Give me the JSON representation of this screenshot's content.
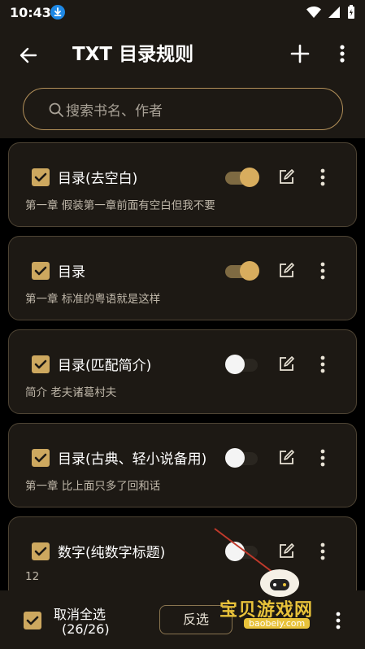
{
  "status_bar": {
    "time": "10:43"
  },
  "app_bar": {
    "title": "TXT 目录规则"
  },
  "search": {
    "placeholder": "搜索书名、作者"
  },
  "rules": [
    {
      "name": "目录(去空白)",
      "description": "第一章 假装第一章前面有空白但我不要",
      "checked": true,
      "enabled": true
    },
    {
      "name": "目录",
      "description": "第一章 标准的粤语就是这样",
      "checked": true,
      "enabled": true
    },
    {
      "name": "目录(匹配简介)",
      "description": "简介 老夫诸葛村夫",
      "checked": true,
      "enabled": false
    },
    {
      "name": "目录(古典、轻小说备用)",
      "description": "第一章 比上面只多了回和话",
      "checked": true,
      "enabled": false
    },
    {
      "name": "数字(纯数字标题)",
      "description": "12",
      "checked": true,
      "enabled": false
    }
  ],
  "bottom_bar": {
    "select_all_label": "取消全选",
    "selection_count": "(26/26)",
    "invert_label": "反选"
  },
  "watermark": {
    "text": "宝贝游戏网",
    "url": "baobeiy.com"
  },
  "colors": {
    "accent": "#cda85f",
    "background": "#1d1914",
    "card_border": "#4e4434"
  },
  "icons": [
    "download-icon",
    "wifi-icon",
    "signal-icon",
    "battery-icon",
    "back-arrow-icon",
    "plus-icon",
    "more-vert-icon",
    "search-icon",
    "checkbox-checked-icon",
    "edit-icon"
  ]
}
